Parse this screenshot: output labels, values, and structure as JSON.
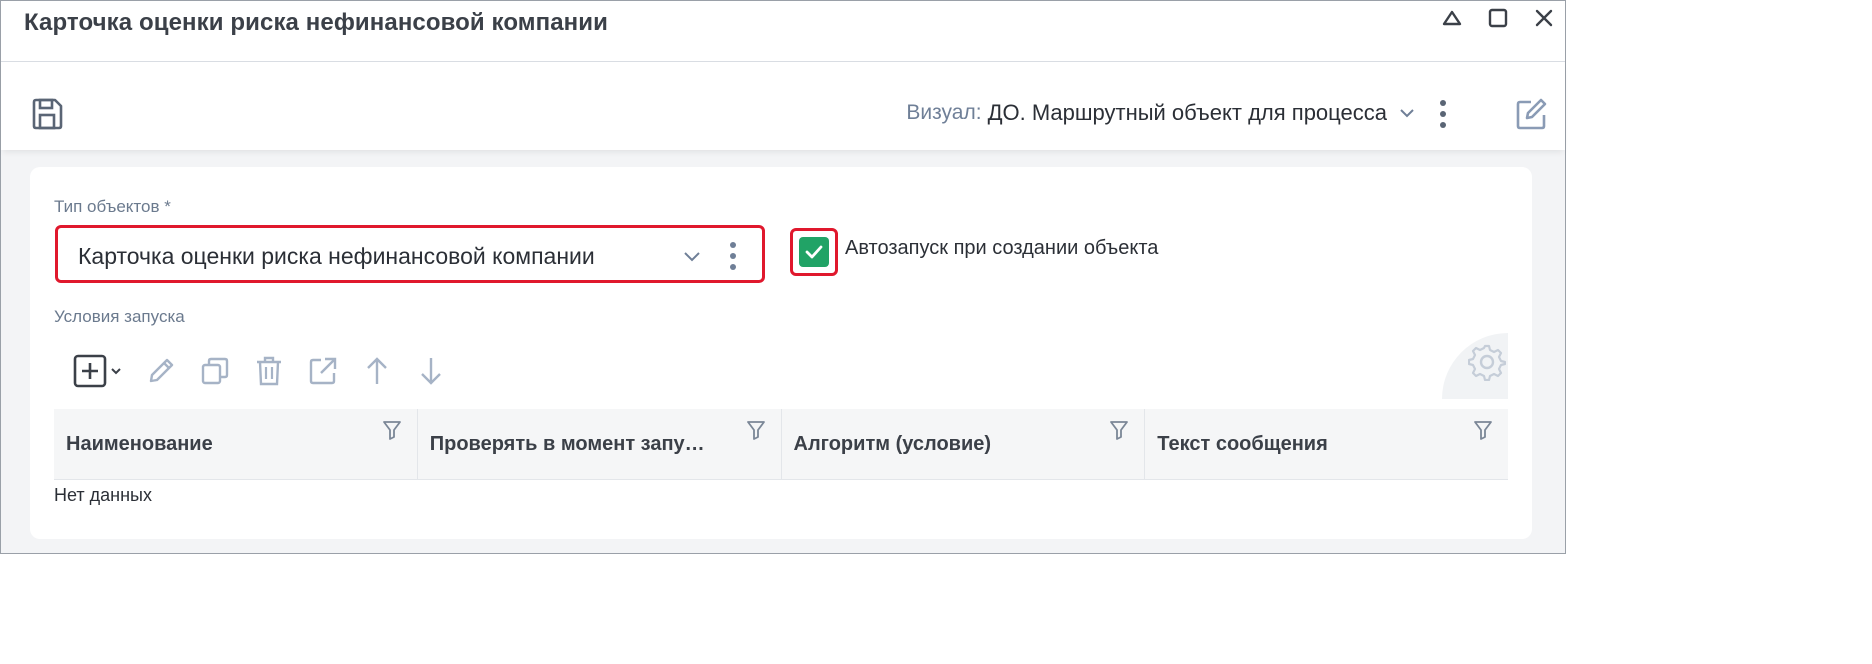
{
  "window": {
    "title": "Карточка оценки риска нефинансовой компании",
    "controls": [
      "minimize-icon",
      "maximize-icon",
      "close-icon"
    ]
  },
  "toolbar": {
    "save_icon": "save-icon",
    "visual_label": "Визуал:",
    "visual_value": "ДО. Маршрутный объект для процесса",
    "edit_icon": "edit-icon"
  },
  "form": {
    "object_type_label": "Тип объектов *",
    "object_type_value": "Карточка оценки риска нефинансовой компании",
    "autostart_label": "Автозапуск при создании объекта",
    "autostart_checked": true,
    "conditions_label": "Условия запуска"
  },
  "grid": {
    "toolbar_icons": [
      "add-icon",
      "edit-pencil-icon",
      "copy-icon",
      "delete-icon",
      "open-external-icon",
      "move-up-icon",
      "move-down-icon"
    ],
    "columns": [
      "Наименование",
      "Проверять в момент запу…",
      "Алгоритм (условие)",
      "Текст сообщения"
    ],
    "empty_text": "Нет данных"
  },
  "colors": {
    "highlight": "#e0182d",
    "checkbox": "#21a366",
    "label": "#6b7a8e",
    "icon": "#8a9bb5"
  }
}
